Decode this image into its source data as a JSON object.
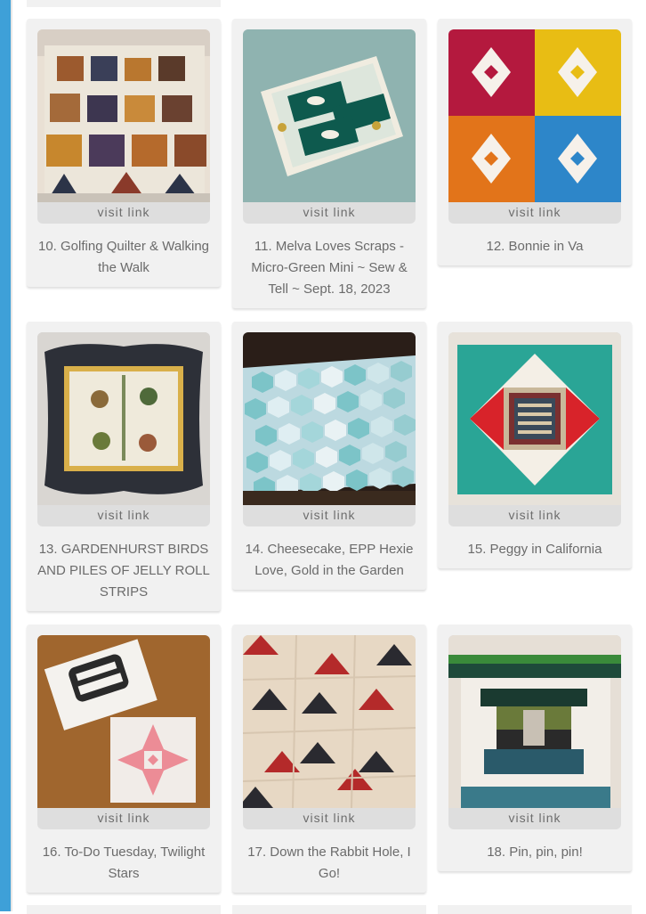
{
  "entries": [
    {
      "visit": "visit link",
      "title": "10. Golfing Quilter & Walking the Walk",
      "image": "pumpkin-quilt-photo"
    },
    {
      "visit": "visit link",
      "title": "11. Melva Loves Scraps - Micro-Green Mini ~ Sew & Tell ~ Sept. 18, 2023",
      "image": "green-mini-quilt-photo"
    },
    {
      "visit": "visit link",
      "title": "12. Bonnie in Va",
      "image": "hourglass-blocks-photo"
    },
    {
      "visit": "visit link",
      "title": "13. GARDENHURST BIRDS AND PILES OF JELLY ROLL STRIPS",
      "image": "applique-birds-quilt-photo"
    },
    {
      "visit": "visit link",
      "title": "14. Cheesecake, EPP Hexie Love, Gold in the Garden",
      "image": "hexie-quilt-photo"
    },
    {
      "visit": "visit link",
      "title": "15. Peggy in California",
      "image": "flag-square-block-photo"
    },
    {
      "visit": "visit link",
      "title": "16. To-Do Tuesday, Twilight Stars",
      "image": "pink-star-block-photo"
    },
    {
      "visit": "visit link",
      "title": "17. Down the Rabbit Hole, I Go!",
      "image": "red-black-star-blocks-photo"
    },
    {
      "visit": "visit link",
      "title": "18. Pin, pin, pin!",
      "image": "log-cabin-block-photo"
    }
  ],
  "colors": {
    "accent_bar": "#3ea0d8",
    "card_bg": "#f1f1f1",
    "button_bg": "#dedede",
    "text": "#6b6b6b"
  }
}
